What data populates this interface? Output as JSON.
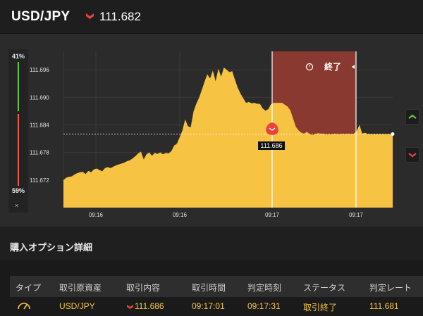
{
  "header": {
    "pair": "USD/JPY",
    "direction_icon": "down-arrow-icon",
    "rate": "111.682",
    "direction_color": "#e8413e"
  },
  "ratio": {
    "up_label": "41%",
    "down_label": "59%",
    "up_fraction": 0.41,
    "down_fraction": 0.59,
    "up_color": "#6cc24a",
    "down_color": "#e8603e",
    "close_label": "×"
  },
  "chart": {
    "end_label": "終了",
    "end_icon": "clock-icon",
    "entry_label": "111.686",
    "current_rate": 111.682,
    "expired_zone_color": "#8f3a30",
    "area_color": "#f6c343"
  },
  "chart_data": {
    "type": "area",
    "ylabel": "",
    "y_ticks": [
      "111.696",
      "111.690",
      "111.684",
      "111.678",
      "111.672"
    ],
    "y_tick_values": [
      111.696,
      111.69,
      111.684,
      111.678,
      111.672
    ],
    "x_ticks": [
      "09:16",
      "09:16",
      "09:17",
      "09:17"
    ],
    "ylim": [
      111.666,
      111.7
    ],
    "series": [
      {
        "values": [
          111.672,
          111.6725,
          111.6727,
          111.6728,
          111.6732,
          111.6735,
          111.6737,
          111.6738,
          111.6733,
          111.674,
          111.6737,
          111.6743,
          111.6745,
          111.6742,
          111.6739,
          111.6746,
          111.6748,
          111.6746,
          111.6749,
          111.6752,
          111.6754,
          111.6756,
          111.6758,
          111.6761,
          111.6763,
          111.6767,
          111.6772,
          111.6778,
          111.6782,
          111.6765,
          111.6776,
          111.678,
          111.6773,
          111.6779,
          111.6777,
          111.678,
          111.6776,
          111.6779,
          111.6778,
          111.6783,
          111.6795,
          111.6799,
          111.6813,
          111.6828,
          111.6852,
          111.6837,
          111.6835,
          111.6869,
          111.6886,
          111.6899,
          111.6916,
          111.6934,
          111.695,
          111.6941,
          111.6958,
          111.6935,
          111.6962,
          111.6945,
          111.6965,
          111.696,
          111.6955,
          111.6957,
          111.6938,
          111.6921,
          111.6908,
          111.6898,
          111.6888,
          111.689,
          111.6887,
          111.6888,
          111.6886,
          111.6886,
          111.6876,
          111.6871,
          111.6874,
          111.6885,
          111.6888,
          111.6888,
          111.6888,
          111.6888,
          111.6884,
          111.688,
          111.6872,
          111.6854,
          111.6836,
          111.6828,
          111.6823,
          111.6821,
          111.6825,
          111.682,
          111.6818,
          111.682,
          111.6822,
          111.6821,
          111.6821,
          111.6819,
          111.682,
          111.6819,
          111.6821,
          111.682,
          111.682,
          111.6821,
          111.682,
          111.6821,
          111.682,
          111.6821,
          111.6827,
          111.684,
          111.6821,
          111.6823,
          111.682,
          111.682,
          111.682,
          111.682,
          111.682,
          111.682,
          111.682,
          111.682,
          111.682,
          111.682
        ]
      }
    ],
    "grid": true
  },
  "section": {
    "title": "購入オプション詳細"
  },
  "table": {
    "headers": [
      "タイプ",
      "取引原資産",
      "取引内容",
      "取引時間",
      "判定時刻",
      "ステータス",
      "判定レート"
    ],
    "row": {
      "type_icon": "gauge-icon",
      "asset": "USD/JPY",
      "trade_icon": "down-arrow-icon",
      "trade_rate": "111.686",
      "trade_time": "09:17:01",
      "judge_time": "09:17:31",
      "status": "取引終了",
      "judge_rate": "111.681"
    }
  },
  "side": {
    "up_icon": "chevron-up-icon",
    "down_icon": "chevron-down-icon"
  }
}
